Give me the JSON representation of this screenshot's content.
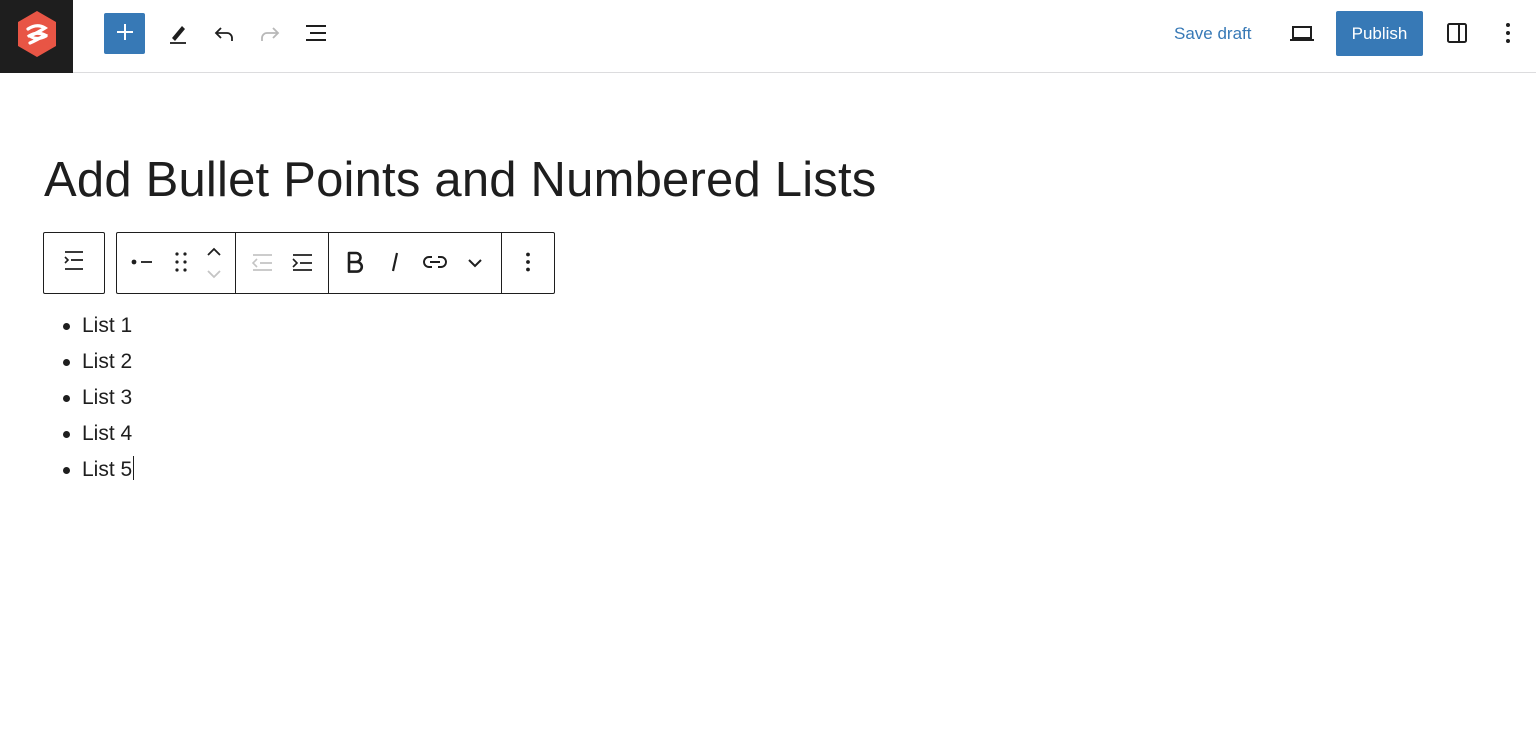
{
  "header": {
    "logo_icon": "brand-logo-icon",
    "inserter_icon": "plus-icon",
    "tools_icon": "pencil-icon",
    "undo_icon": "undo-icon",
    "redo_icon": "redo-icon",
    "document_overview_icon": "list-view-icon",
    "save_draft_label": "Save draft",
    "preview_icon": "laptop-icon",
    "publish_label": "Publish",
    "settings_icon": "sidebar-icon",
    "options_icon": "vertical-ellipsis-icon",
    "accent_color": "#3779b6"
  },
  "editor": {
    "title": "Add Bullet Points and Numbered Lists",
    "block_toolbar": {
      "parent_icon": "list-parent-icon",
      "block_type_icon": "list-item-icon",
      "drag_icon": "drag-handle-icon",
      "move_up_icon": "chevron-up-icon",
      "move_down_icon": "chevron-down-icon",
      "outdent_icon": "outdent-icon",
      "indent_icon": "indent-icon",
      "bold_icon": "bold-icon",
      "italic_icon": "italic-icon",
      "link_icon": "link-icon",
      "more_icon": "chevron-down-icon",
      "options_icon": "vertical-ellipsis-icon"
    },
    "list_items": [
      "List 1",
      "List 2",
      "List 3",
      "List 4",
      "List 5"
    ]
  }
}
